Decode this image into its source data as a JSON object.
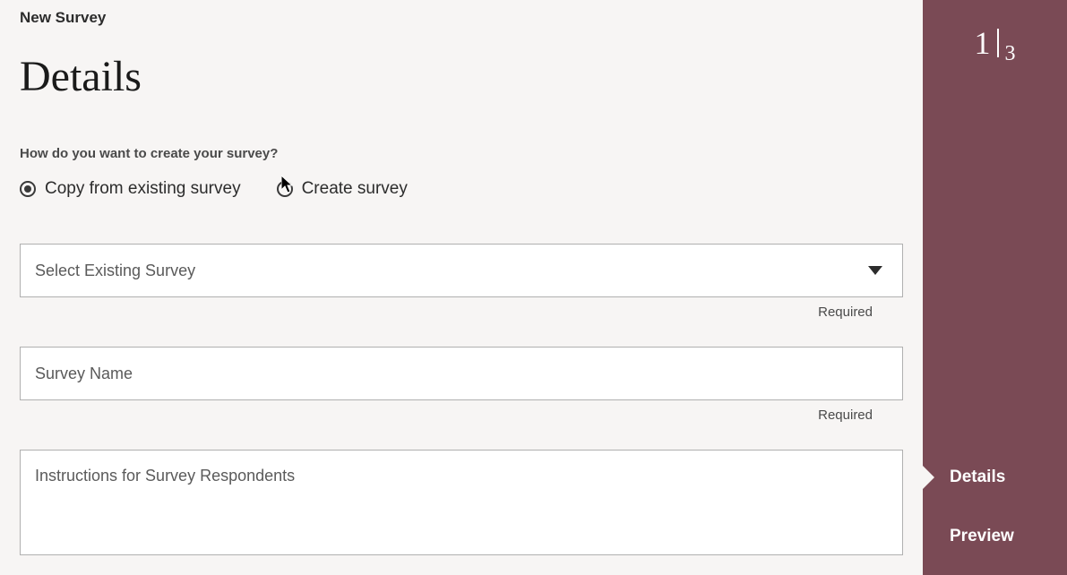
{
  "breadcrumb": "New Survey",
  "page_title": "Details",
  "question": "How do you want to create your survey?",
  "radio_options": {
    "copy_label": "Copy from existing survey",
    "create_label": "Create survey"
  },
  "fields": {
    "select_survey_placeholder": "Select Existing Survey",
    "survey_name_placeholder": "Survey Name",
    "instructions_placeholder": "Instructions for Survey Respondents",
    "required_text": "Required"
  },
  "sidebar": {
    "step_current": "1",
    "step_total": "3",
    "items": {
      "details": "Details",
      "preview": "Preview"
    }
  }
}
